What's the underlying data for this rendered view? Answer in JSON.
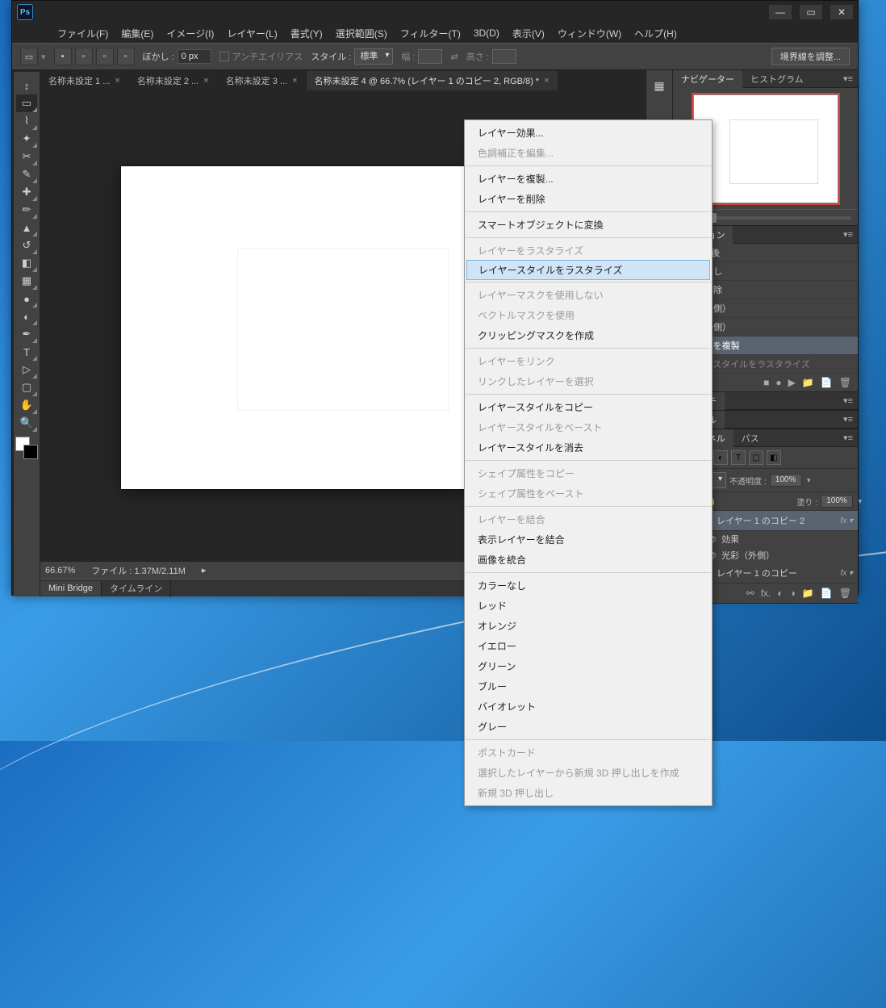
{
  "menubar": {
    "file": "ファイル(F)",
    "edit": "編集(E)",
    "image": "イメージ(I)",
    "layer": "レイヤー(L)",
    "type": "書式(Y)",
    "select": "選択範囲(S)",
    "filter": "フィルター(T)",
    "threeD": "3D(D)",
    "view": "表示(V)",
    "window": "ウィンドウ(W)",
    "help": "ヘルプ(H)"
  },
  "options": {
    "feather_label": "ぼかし :",
    "feather_value": "0 px",
    "antialias": "アンチエイリアス",
    "style_label": "スタイル :",
    "style_value": "標準",
    "width_label": "幅 :",
    "height_label": "高さ :",
    "refine_edge": "境界線を調整..."
  },
  "doc_tabs": [
    "名称未設定 1 ...",
    "名称未設定 2 ...",
    "名称未設定 3 ...",
    "名称未設定 4 @ 66.7% (レイヤー 1 のコピー 2, RGB/8) *"
  ],
  "status": {
    "zoom": "66.67%",
    "docinfo": "ファイル : 1.37M/2.11M"
  },
  "bottom_tabs": {
    "mini_bridge": "Mini Bridge",
    "timeline": "タイムライン"
  },
  "panels": {
    "navigator": "ナビゲーター",
    "histogram": "ヒストグラム",
    "actions": "アクション",
    "actions_items": {
      "prev": "近後後",
      "fill": "塗りつぶし",
      "deselect": "選択を解除",
      "glow1": "光彩（外側）",
      "glow2": "光彩（外側）",
      "duplicate": "レイヤーを複製",
      "rasterize_style_dim": "レイヤースタイルをラスタライズ"
    },
    "swatches": "ウォッチ",
    "styles": "スタイル",
    "channels": "チャンネル",
    "paths": "パス",
    "opacity_label": "不透明度 :",
    "opacity_value": "100%",
    "fill_label": "塗り :",
    "fill_value": "100%",
    "layers": {
      "layer1_copy2": "レイヤー 1 のコピー 2",
      "effects": "効果",
      "outer_glow": "光彩（外側）",
      "layer1_copy": "レイヤー 1 のコピー"
    }
  },
  "ctx": {
    "layer_effects": "レイヤー効果...",
    "edit_adjustment": "色調補正を編集...",
    "duplicate_layer": "レイヤーを複製...",
    "delete_layer": "レイヤーを削除",
    "convert_smart": "スマートオブジェクトに変換",
    "rasterize_layer": "レイヤーをラスタライズ",
    "rasterize_style": "レイヤースタイルをラスタライズ",
    "disable_mask": "レイヤーマスクを使用しない",
    "enable_vector_mask": "ベクトルマスクを使用",
    "create_clip_mask": "クリッピングマスクを作成",
    "link_layers": "レイヤーをリンク",
    "select_linked": "リンクしたレイヤーを選択",
    "copy_style": "レイヤースタイルをコピー",
    "paste_style": "レイヤースタイルをペースト",
    "clear_style": "レイヤースタイルを消去",
    "copy_shape_attr": "シェイプ属性をコピー",
    "paste_shape_attr": "シェイプ属性をペースト",
    "merge_layers": "レイヤーを結合",
    "merge_visible": "表示レイヤーを結合",
    "flatten": "画像を統合",
    "no_color": "カラーなし",
    "red": "レッド",
    "orange": "オレンジ",
    "yellow": "イエロー",
    "green": "グリーン",
    "blue": "ブルー",
    "violet": "バイオレット",
    "gray": "グレー",
    "postcard": "ポストカード",
    "new_3d_extrusion": "選択したレイヤーから新規 3D 押し出しを作成",
    "new_3d_extrusion2": "新規 3D 押し出し"
  }
}
